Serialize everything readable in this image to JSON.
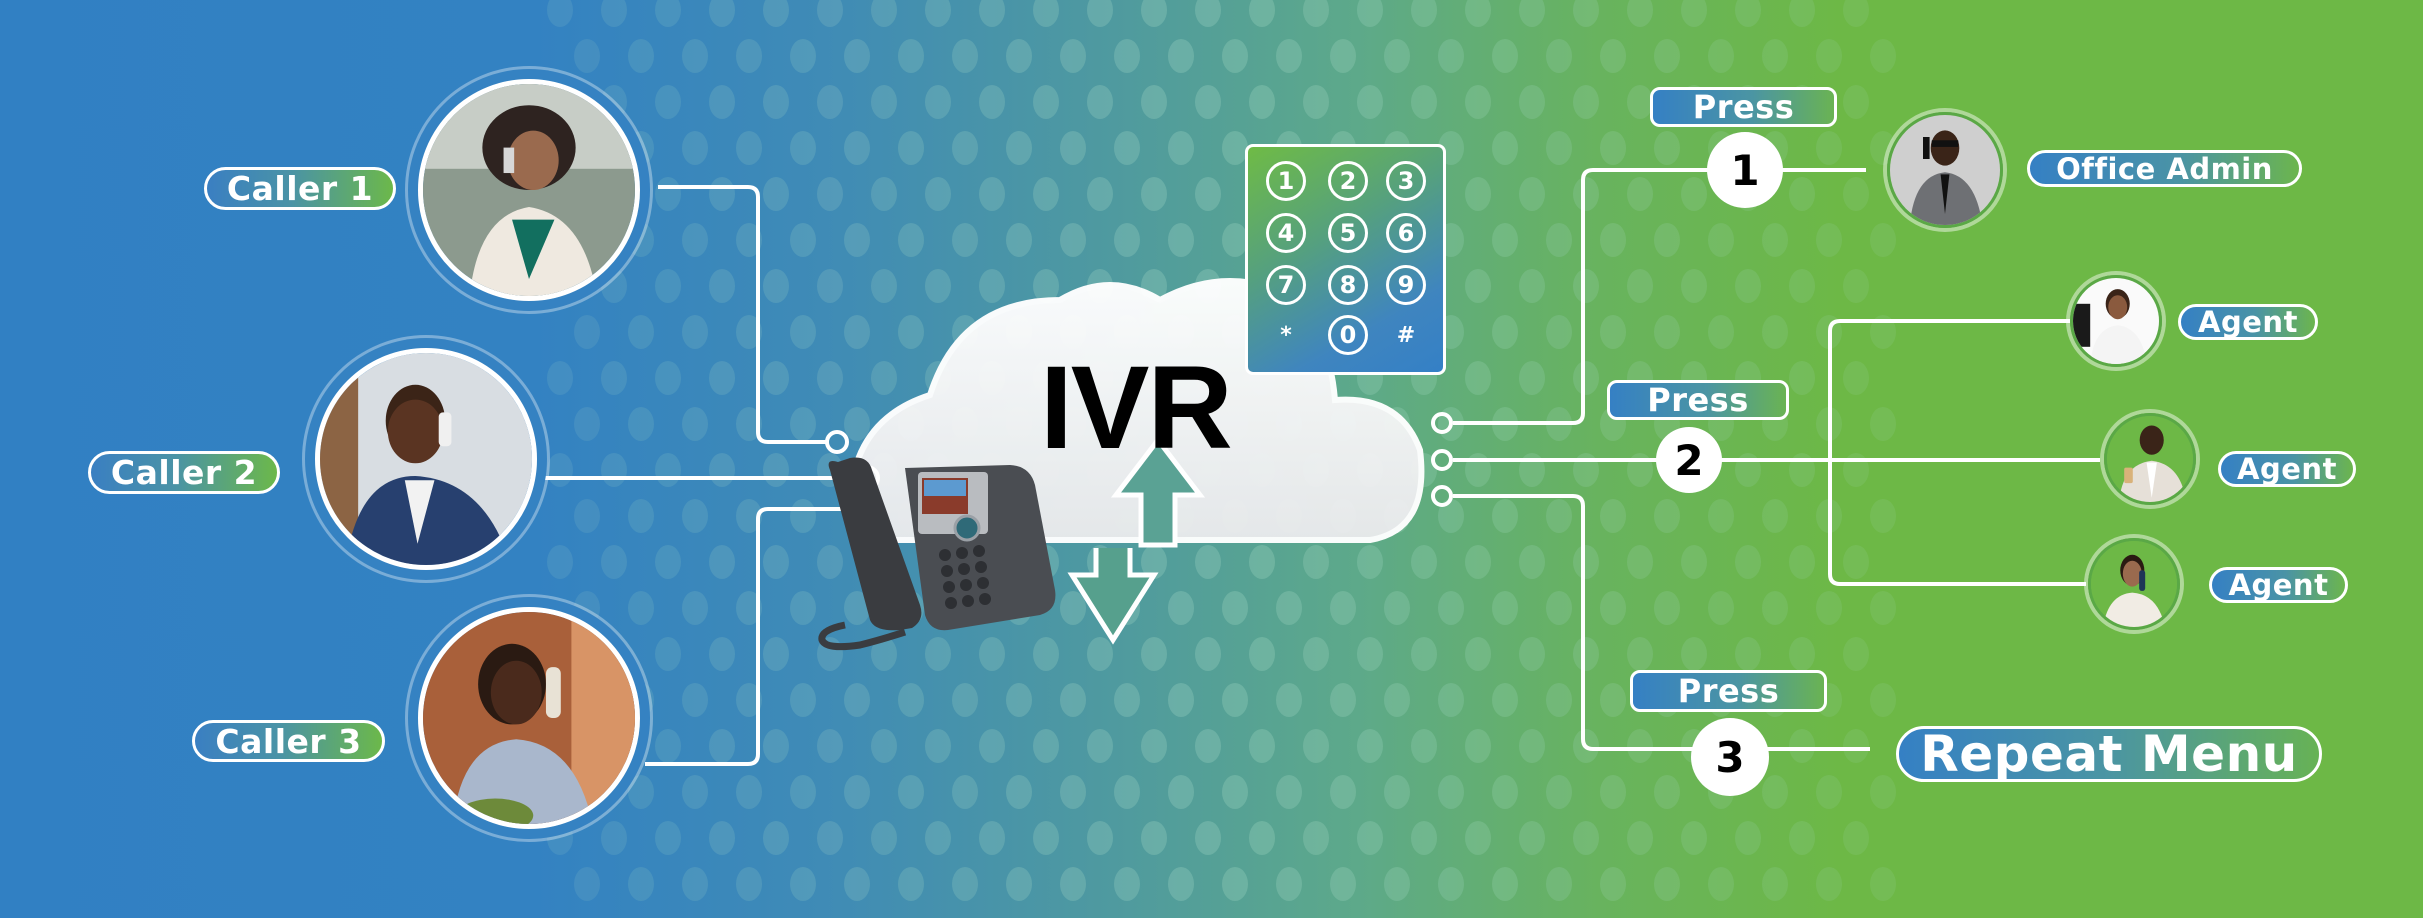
{
  "title": "IVR",
  "colors": {
    "background_left": "#3180c3",
    "background_right": "#6db846",
    "line": "#ffffff",
    "label_text": "#ffffff",
    "ivr_text": "#000000"
  },
  "callers": [
    {
      "label": "Caller 1",
      "icon": "woman-on-phone-photo"
    },
    {
      "label": "Caller 2",
      "icon": "man-on-phone-photo"
    },
    {
      "label": "Caller 3",
      "icon": "woman-on-desk-phone-photo"
    }
  ],
  "center": {
    "label": "IVR",
    "cloud_icon": "cloud-icon",
    "phone_icon": "desk-phone-icon",
    "arrows_icon": "up-down-arrows-icon"
  },
  "keypad": {
    "keys": [
      "1",
      "2",
      "3",
      "4",
      "5",
      "6",
      "7",
      "8",
      "9",
      "*",
      "0",
      "#"
    ]
  },
  "options": [
    {
      "press_label": "Press",
      "digit": "1",
      "destination": "Office Admin"
    },
    {
      "press_label": "Press",
      "digit": "2",
      "destination": "Agent"
    },
    {
      "press_label": "Press",
      "digit": "3",
      "destination": "Repeat Menu"
    }
  ],
  "agents": [
    {
      "label": "Agent"
    },
    {
      "label": "Agent"
    },
    {
      "label": "Agent"
    }
  ]
}
